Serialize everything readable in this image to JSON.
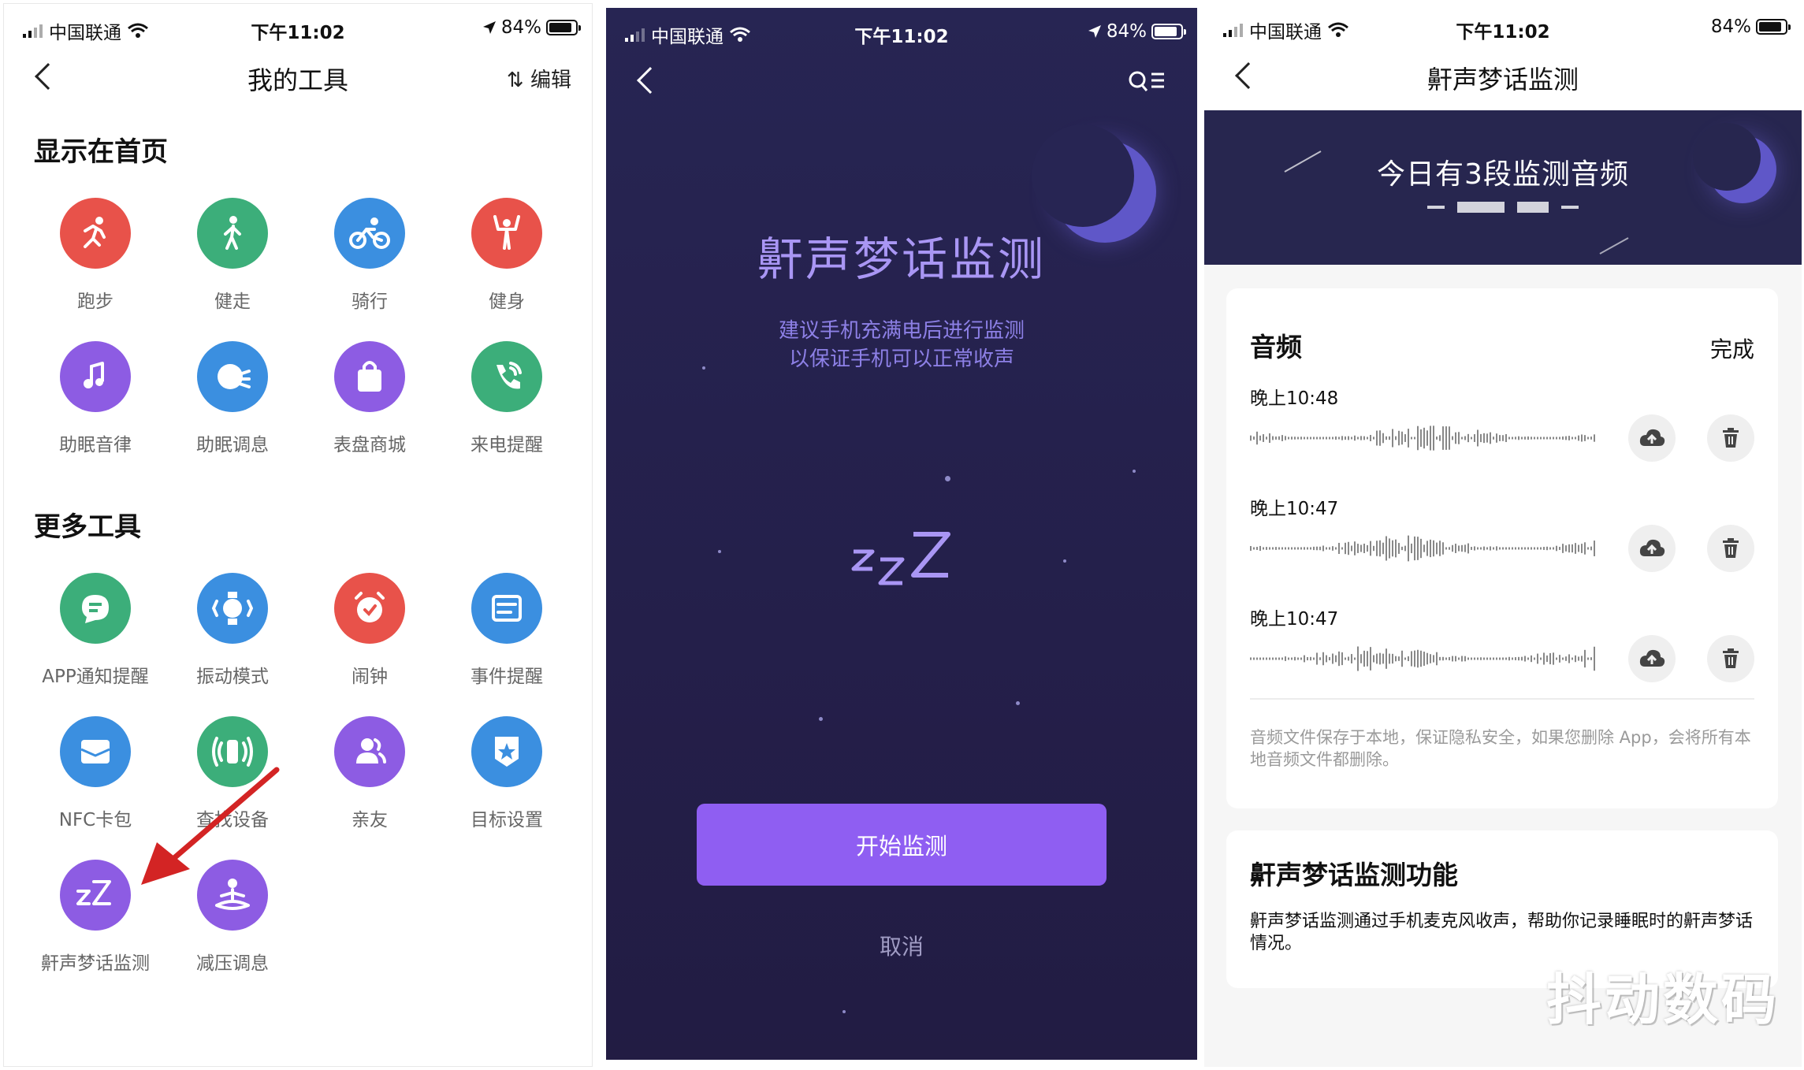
{
  "status_bar": {
    "carrier": "中国联通",
    "time": "下午11:02",
    "battery": "84%"
  },
  "panel1": {
    "nav_title": "我的工具",
    "edit_label": "编辑",
    "section_home": "显示在首页",
    "section_more": "更多工具",
    "home_tools": [
      {
        "label": "跑步",
        "icon": "running-icon",
        "color": "#e8524a"
      },
      {
        "label": "健走",
        "icon": "walking-icon",
        "color": "#3cae7a"
      },
      {
        "label": "骑行",
        "icon": "cycling-icon",
        "color": "#3b8fe0"
      },
      {
        "label": "健身",
        "icon": "fitness-icon",
        "color": "#e8524a"
      },
      {
        "label": "助眠音律",
        "icon": "music-note-icon",
        "color": "#8d5ce3"
      },
      {
        "label": "助眠调息",
        "icon": "breathing-face-icon",
        "color": "#3b8fe0"
      },
      {
        "label": "表盘商城",
        "icon": "shopping-bag-icon",
        "color": "#8d5ce3"
      },
      {
        "label": "来电提醒",
        "icon": "phone-call-icon",
        "color": "#3cae7a"
      }
    ],
    "more_tools": [
      {
        "label": "APP通知提醒",
        "icon": "chat-bubble-icon",
        "color": "#3cae7a"
      },
      {
        "label": "振动模式",
        "icon": "vibration-icon",
        "color": "#3b8fe0"
      },
      {
        "label": "闹钟",
        "icon": "alarm-clock-icon",
        "color": "#e8524a"
      },
      {
        "label": "事件提醒",
        "icon": "event-card-icon",
        "color": "#3b8fe0"
      },
      {
        "label": "NFC卡包",
        "icon": "card-wallet-icon",
        "color": "#3b8fe0"
      },
      {
        "label": "查找设备",
        "icon": "find-device-icon",
        "color": "#3cae7a"
      },
      {
        "label": "亲友",
        "icon": "friends-icon",
        "color": "#8d5ce3"
      },
      {
        "label": "目标设置",
        "icon": "goal-badge-icon",
        "color": "#3b8fe0"
      },
      {
        "label": "鼾声梦话监测",
        "icon": "zz-sleep-icon",
        "color": "#8d5ce3"
      },
      {
        "label": "减压调息",
        "icon": "meditation-icon",
        "color": "#8d5ce3"
      }
    ]
  },
  "panel2": {
    "title": "鼾声梦话监测",
    "subtitle_line1": "建议手机充满电后进行监测",
    "subtitle_line2": "以保证手机可以正常收声",
    "start_button": "开始监测",
    "cancel": "取消"
  },
  "panel3": {
    "nav_title": "鼾声梦话监测",
    "banner_text": "今日有3段监测音频",
    "audio_heading": "音频",
    "done_label": "完成",
    "recordings": [
      {
        "time": "晚上10:48"
      },
      {
        "time": "晚上10:47"
      },
      {
        "time": "晚上10:47"
      }
    ],
    "storage_note": "音频文件保存于本地，保证隐私安全，如果您删除 App，会将所有本地音频文件都删除。",
    "feature_heading": "鼾声梦话监测功能",
    "feature_desc": "鼾声梦话监测通过手机麦克风收声，帮助你记录睡眠时的鼾声梦话情况。"
  },
  "watermark": "抖动数码",
  "colors": {
    "primary_purple": "#8f5ef2",
    "night_bg": "#272553",
    "title_purple": "#a996f4"
  }
}
